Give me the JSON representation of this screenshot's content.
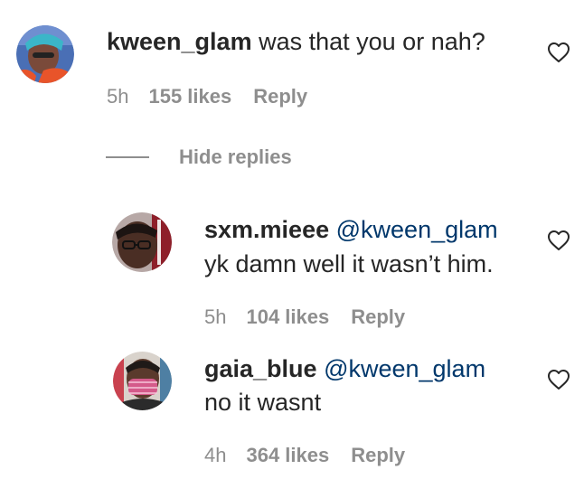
{
  "comment": {
    "username": "kween_glam",
    "text": "was that you or nah?",
    "time": "5h",
    "likes": "155 likes",
    "reply_label": "Reply",
    "like_icon": "heart-outline-icon"
  },
  "hide_replies_label": "Hide replies",
  "replies": [
    {
      "username": "sxm.mieee",
      "mention": "@kween_glam",
      "text": "yk damn well it wasn’t him.",
      "time": "5h",
      "likes": "104 likes",
      "reply_label": "Reply",
      "like_icon": "heart-outline-icon"
    },
    {
      "username": "gaia_blue",
      "mention": "@kween_glam",
      "text": "no it wasnt",
      "time": "4h",
      "likes": "364 likes",
      "reply_label": "Reply",
      "like_icon": "heart-outline-icon"
    }
  ],
  "colors": {
    "text": "#262626",
    "muted": "#8e8e8e",
    "mention": "#00376b",
    "background": "#ffffff"
  }
}
